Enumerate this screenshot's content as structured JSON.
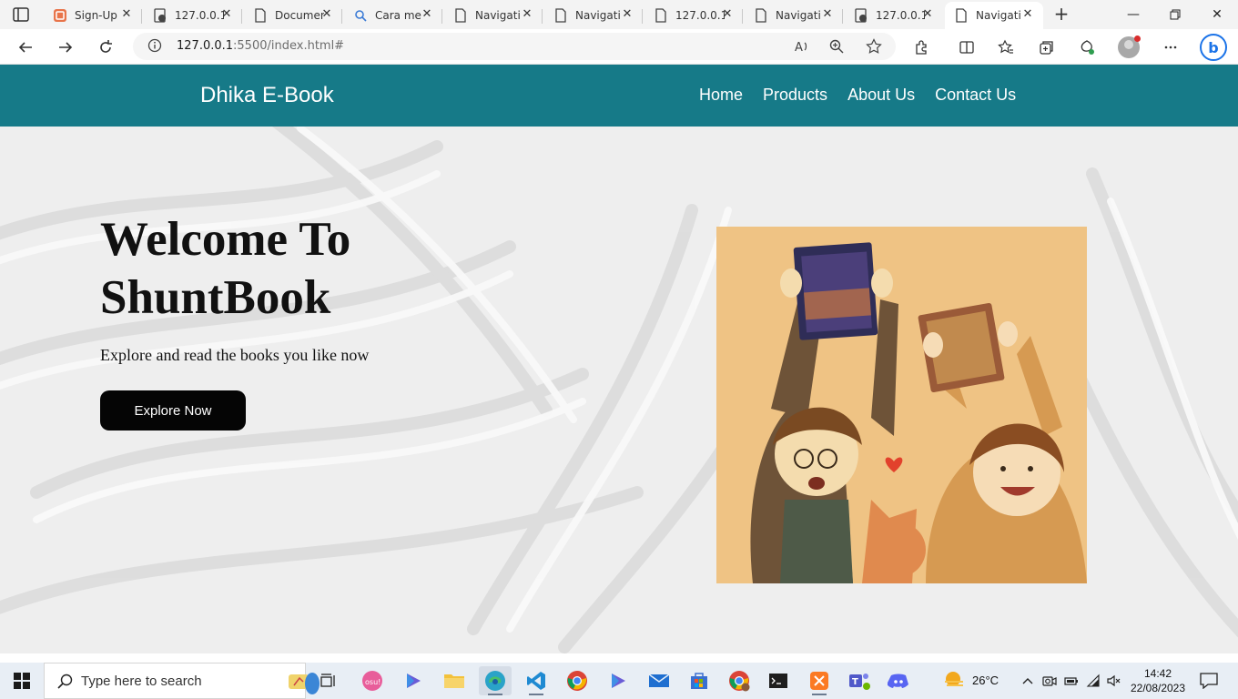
{
  "browser": {
    "tabs": [
      {
        "title": "Sign-Up",
        "icon": "sign-up-favicon"
      },
      {
        "title": "127.0.0.1",
        "icon": "local-server-favicon"
      },
      {
        "title": "Document",
        "icon": "page-favicon"
      },
      {
        "title": "Cara me",
        "icon": "search-favicon"
      },
      {
        "title": "Navigati",
        "icon": "page-favicon"
      },
      {
        "title": "Navigati",
        "icon": "page-favicon"
      },
      {
        "title": "127.0.0.1",
        "icon": "page-favicon"
      },
      {
        "title": "Navigati",
        "icon": "page-favicon"
      },
      {
        "title": "127.0.0.1",
        "icon": "local-server-favicon"
      },
      {
        "title": "Navigati",
        "icon": "page-favicon",
        "active": true
      }
    ],
    "url_host": "127.0.0.1",
    "url_rest": ":5500/index.html#"
  },
  "page": {
    "brand": "Dhika E-Book",
    "nav": [
      "Home",
      "Products",
      "About Us",
      "Contact Us"
    ],
    "hero": {
      "title_line1": "Welcome To",
      "title_line2": "ShuntBook",
      "subtitle": "Explore and read the books you like now",
      "button": "Explore Now"
    }
  },
  "taskbar": {
    "search_placeholder": "Type here to search",
    "weather": "26°C",
    "time": "14:42",
    "date": "22/08/2023"
  },
  "colors": {
    "navbar": "#167a88",
    "button": "#050505"
  }
}
